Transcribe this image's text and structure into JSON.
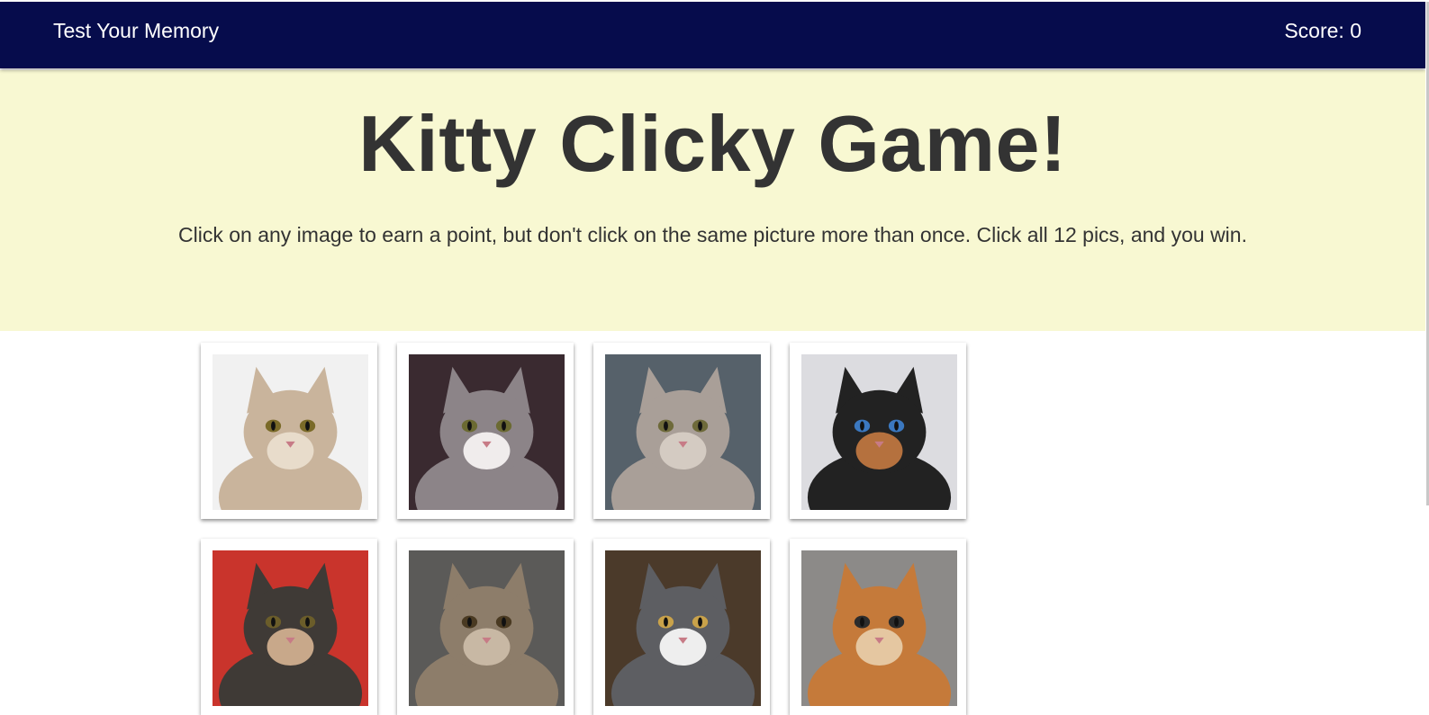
{
  "navbar": {
    "brand": "Test Your Memory",
    "score": "Score: 0"
  },
  "hero": {
    "title": "Kitty Clicky Game!",
    "instructions": "Click on any image to earn a point, but don't click on the same picture more than once. Click all 12 pics, and you win."
  },
  "cards": [
    {
      "subject": "fluffy-cream-cat-meowing",
      "bg": "#f1f1f1",
      "fur": "#c9b49c",
      "accent": "#e8dccb",
      "eye": "#7a6a28"
    },
    {
      "subject": "grey-white-longhair-cat",
      "bg": "#3a2a30",
      "fur": "#8c8488",
      "accent": "#f0ecec",
      "eye": "#6b6a32"
    },
    {
      "subject": "grey-cat-lying-on-couch",
      "bg": "#56616a",
      "fur": "#a99f98",
      "accent": "#d4cbc2",
      "eye": "#6e6a3a"
    },
    {
      "subject": "two-faced-chimera-cat",
      "bg": "#dcdce0",
      "fur": "#222222",
      "accent": "#b5713e",
      "eye": "#3b78c0"
    },
    {
      "subject": "calico-cat-in-box",
      "bg": "#c9342c",
      "fur": "#3f3a36",
      "accent": "#c8a88a",
      "eye": "#6b5d2a"
    },
    {
      "subject": "surprised-tabby-kitten",
      "bg": "#5b5a58",
      "fur": "#8d7d6a",
      "accent": "#c8b8a4",
      "eye": "#4a3a22"
    },
    {
      "subject": "grey-cat-sitting-on-floor",
      "bg": "#4b3a2a",
      "fur": "#5d5e62",
      "accent": "#eeeeee",
      "eye": "#c9a24a"
    },
    {
      "subject": "orange-cat-selfie",
      "bg": "#8c8a88",
      "fur": "#c57a3a",
      "accent": "#e5c7a1",
      "eye": "#2c2c2c"
    }
  ]
}
